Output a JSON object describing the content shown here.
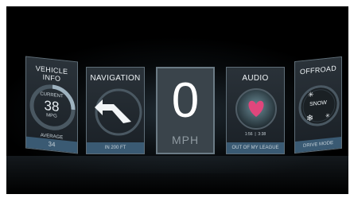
{
  "cards": {
    "vehicle": {
      "title": "VEHICLE INFO",
      "current_label": "CURRENT",
      "current_value": "38",
      "current_unit": "MPG",
      "average_label": "AVERAGE",
      "average_value": "34"
    },
    "navigation": {
      "title": "NAVIGATION",
      "footer": "IN 200 FT"
    },
    "speed": {
      "value": "0",
      "unit": "MPH"
    },
    "audio": {
      "title": "AUDIO",
      "elapsed": "1:56",
      "duration": "3:38",
      "footer": "OUT OF MY LEAGUE"
    },
    "offroad": {
      "title": "OFFROAD",
      "mode": "SNOW",
      "footer": "DRIVE MODE"
    }
  },
  "colors": {
    "accent_blue": "#3a5a73",
    "heart_pink": "#e0467c",
    "background": "#000000"
  }
}
